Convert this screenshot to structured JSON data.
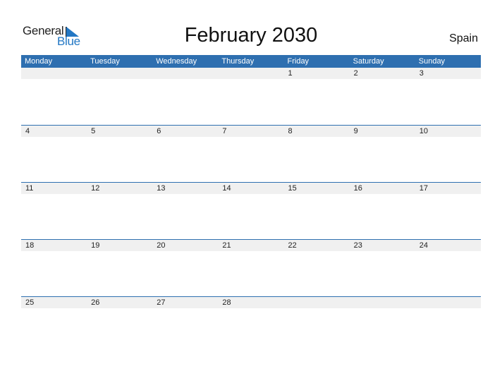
{
  "logo": {
    "line1": "General",
    "line2": "Blue"
  },
  "title": "February 2030",
  "country": "Spain",
  "colors": {
    "accent": "#2e6fb0",
    "strip": "#f0f0f0",
    "logo_blue": "#2277c4"
  },
  "days": [
    "Monday",
    "Tuesday",
    "Wednesday",
    "Thursday",
    "Friday",
    "Saturday",
    "Sunday"
  ],
  "weeks": [
    [
      "",
      "",
      "",
      "",
      "1",
      "2",
      "3"
    ],
    [
      "4",
      "5",
      "6",
      "7",
      "8",
      "9",
      "10"
    ],
    [
      "11",
      "12",
      "13",
      "14",
      "15",
      "16",
      "17"
    ],
    [
      "18",
      "19",
      "20",
      "21",
      "22",
      "23",
      "24"
    ],
    [
      "25",
      "26",
      "27",
      "28",
      "",
      "",
      ""
    ]
  ]
}
